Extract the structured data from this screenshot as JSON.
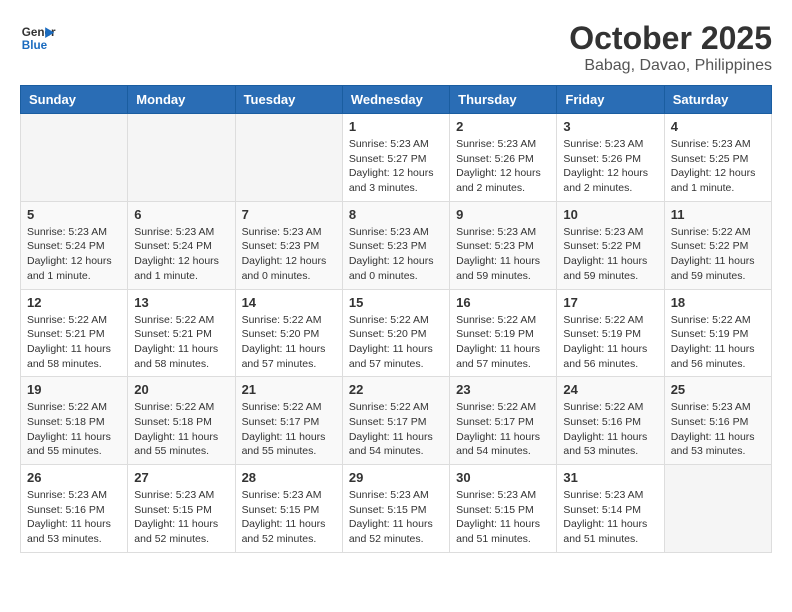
{
  "header": {
    "logo_line1": "General",
    "logo_line2": "Blue",
    "month": "October 2025",
    "location": "Babag, Davao, Philippines"
  },
  "weekdays": [
    "Sunday",
    "Monday",
    "Tuesday",
    "Wednesday",
    "Thursday",
    "Friday",
    "Saturday"
  ],
  "weeks": [
    [
      {
        "day": "",
        "sunrise": "",
        "sunset": "",
        "daylight": ""
      },
      {
        "day": "",
        "sunrise": "",
        "sunset": "",
        "daylight": ""
      },
      {
        "day": "",
        "sunrise": "",
        "sunset": "",
        "daylight": ""
      },
      {
        "day": "1",
        "sunrise": "Sunrise: 5:23 AM",
        "sunset": "Sunset: 5:27 PM",
        "daylight": "Daylight: 12 hours and 3 minutes."
      },
      {
        "day": "2",
        "sunrise": "Sunrise: 5:23 AM",
        "sunset": "Sunset: 5:26 PM",
        "daylight": "Daylight: 12 hours and 2 minutes."
      },
      {
        "day": "3",
        "sunrise": "Sunrise: 5:23 AM",
        "sunset": "Sunset: 5:26 PM",
        "daylight": "Daylight: 12 hours and 2 minutes."
      },
      {
        "day": "4",
        "sunrise": "Sunrise: 5:23 AM",
        "sunset": "Sunset: 5:25 PM",
        "daylight": "Daylight: 12 hours and 1 minute."
      }
    ],
    [
      {
        "day": "5",
        "sunrise": "Sunrise: 5:23 AM",
        "sunset": "Sunset: 5:24 PM",
        "daylight": "Daylight: 12 hours and 1 minute."
      },
      {
        "day": "6",
        "sunrise": "Sunrise: 5:23 AM",
        "sunset": "Sunset: 5:24 PM",
        "daylight": "Daylight: 12 hours and 1 minute."
      },
      {
        "day": "7",
        "sunrise": "Sunrise: 5:23 AM",
        "sunset": "Sunset: 5:23 PM",
        "daylight": "Daylight: 12 hours and 0 minutes."
      },
      {
        "day": "8",
        "sunrise": "Sunrise: 5:23 AM",
        "sunset": "Sunset: 5:23 PM",
        "daylight": "Daylight: 12 hours and 0 minutes."
      },
      {
        "day": "9",
        "sunrise": "Sunrise: 5:23 AM",
        "sunset": "Sunset: 5:23 PM",
        "daylight": "Daylight: 11 hours and 59 minutes."
      },
      {
        "day": "10",
        "sunrise": "Sunrise: 5:23 AM",
        "sunset": "Sunset: 5:22 PM",
        "daylight": "Daylight: 11 hours and 59 minutes."
      },
      {
        "day": "11",
        "sunrise": "Sunrise: 5:22 AM",
        "sunset": "Sunset: 5:22 PM",
        "daylight": "Daylight: 11 hours and 59 minutes."
      }
    ],
    [
      {
        "day": "12",
        "sunrise": "Sunrise: 5:22 AM",
        "sunset": "Sunset: 5:21 PM",
        "daylight": "Daylight: 11 hours and 58 minutes."
      },
      {
        "day": "13",
        "sunrise": "Sunrise: 5:22 AM",
        "sunset": "Sunset: 5:21 PM",
        "daylight": "Daylight: 11 hours and 58 minutes."
      },
      {
        "day": "14",
        "sunrise": "Sunrise: 5:22 AM",
        "sunset": "Sunset: 5:20 PM",
        "daylight": "Daylight: 11 hours and 57 minutes."
      },
      {
        "day": "15",
        "sunrise": "Sunrise: 5:22 AM",
        "sunset": "Sunset: 5:20 PM",
        "daylight": "Daylight: 11 hours and 57 minutes."
      },
      {
        "day": "16",
        "sunrise": "Sunrise: 5:22 AM",
        "sunset": "Sunset: 5:19 PM",
        "daylight": "Daylight: 11 hours and 57 minutes."
      },
      {
        "day": "17",
        "sunrise": "Sunrise: 5:22 AM",
        "sunset": "Sunset: 5:19 PM",
        "daylight": "Daylight: 11 hours and 56 minutes."
      },
      {
        "day": "18",
        "sunrise": "Sunrise: 5:22 AM",
        "sunset": "Sunset: 5:19 PM",
        "daylight": "Daylight: 11 hours and 56 minutes."
      }
    ],
    [
      {
        "day": "19",
        "sunrise": "Sunrise: 5:22 AM",
        "sunset": "Sunset: 5:18 PM",
        "daylight": "Daylight: 11 hours and 55 minutes."
      },
      {
        "day": "20",
        "sunrise": "Sunrise: 5:22 AM",
        "sunset": "Sunset: 5:18 PM",
        "daylight": "Daylight: 11 hours and 55 minutes."
      },
      {
        "day": "21",
        "sunrise": "Sunrise: 5:22 AM",
        "sunset": "Sunset: 5:17 PM",
        "daylight": "Daylight: 11 hours and 55 minutes."
      },
      {
        "day": "22",
        "sunrise": "Sunrise: 5:22 AM",
        "sunset": "Sunset: 5:17 PM",
        "daylight": "Daylight: 11 hours and 54 minutes."
      },
      {
        "day": "23",
        "sunrise": "Sunrise: 5:22 AM",
        "sunset": "Sunset: 5:17 PM",
        "daylight": "Daylight: 11 hours and 54 minutes."
      },
      {
        "day": "24",
        "sunrise": "Sunrise: 5:22 AM",
        "sunset": "Sunset: 5:16 PM",
        "daylight": "Daylight: 11 hours and 53 minutes."
      },
      {
        "day": "25",
        "sunrise": "Sunrise: 5:23 AM",
        "sunset": "Sunset: 5:16 PM",
        "daylight": "Daylight: 11 hours and 53 minutes."
      }
    ],
    [
      {
        "day": "26",
        "sunrise": "Sunrise: 5:23 AM",
        "sunset": "Sunset: 5:16 PM",
        "daylight": "Daylight: 11 hours and 53 minutes."
      },
      {
        "day": "27",
        "sunrise": "Sunrise: 5:23 AM",
        "sunset": "Sunset: 5:15 PM",
        "daylight": "Daylight: 11 hours and 52 minutes."
      },
      {
        "day": "28",
        "sunrise": "Sunrise: 5:23 AM",
        "sunset": "Sunset: 5:15 PM",
        "daylight": "Daylight: 11 hours and 52 minutes."
      },
      {
        "day": "29",
        "sunrise": "Sunrise: 5:23 AM",
        "sunset": "Sunset: 5:15 PM",
        "daylight": "Daylight: 11 hours and 52 minutes."
      },
      {
        "day": "30",
        "sunrise": "Sunrise: 5:23 AM",
        "sunset": "Sunset: 5:15 PM",
        "daylight": "Daylight: 11 hours and 51 minutes."
      },
      {
        "day": "31",
        "sunrise": "Sunrise: 5:23 AM",
        "sunset": "Sunset: 5:14 PM",
        "daylight": "Daylight: 11 hours and 51 minutes."
      },
      {
        "day": "",
        "sunrise": "",
        "sunset": "",
        "daylight": ""
      }
    ]
  ]
}
